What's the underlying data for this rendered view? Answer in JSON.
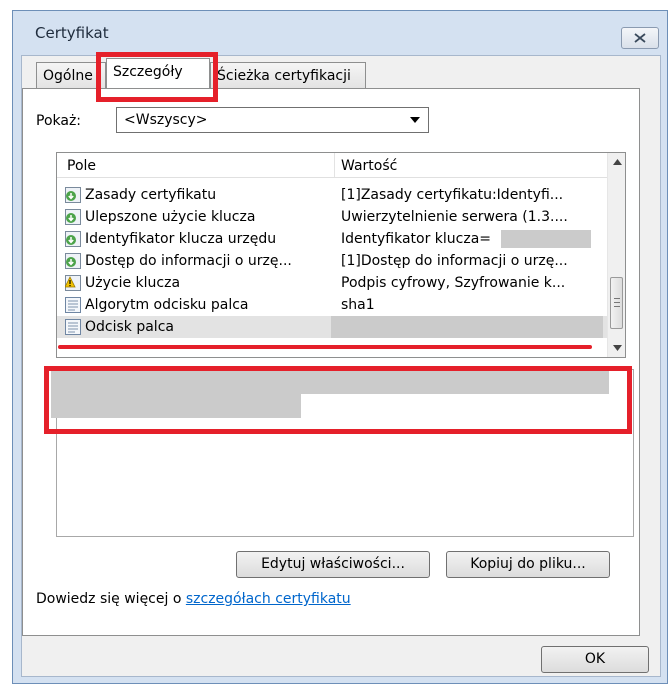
{
  "window": {
    "title": "Certyfikat"
  },
  "tabs": [
    {
      "label": "Ogólne",
      "active": false
    },
    {
      "label": "Szczegóły",
      "active": true
    },
    {
      "label": "Ścieżka certyfikacji",
      "active": false
    }
  ],
  "show_filter": {
    "label": "Pokaż:",
    "selected": "<Wszyscy>"
  },
  "list": {
    "columns": [
      "Pole",
      "Wartość"
    ],
    "rows": [
      {
        "field": "Zasady certyfikatu",
        "value": "[1]Zasady certyfikatu:Identyfi...",
        "icon": "extension-icon"
      },
      {
        "field": "Ulepszone użycie klucza",
        "value": "Uwierzytelnienie serwera (1.3....",
        "icon": "extension-icon"
      },
      {
        "field": "Identyfikator klucza urzędu",
        "value": "Identyfikator klucza=",
        "icon": "extension-icon",
        "redacted": true
      },
      {
        "field": "Dostęp do informacji o urzę...",
        "value": "[1]Dostęp do informacji o urzę...",
        "icon": "extension-icon"
      },
      {
        "field": "Użycie klucza",
        "value": "Podpis cyfrowy, Szyfrowanie k...",
        "icon": "critical-extension-icon"
      },
      {
        "field": "Algorytm odcisku palca",
        "value": "sha1",
        "icon": "property-icon"
      },
      {
        "field": "Odcisk palca",
        "value": "",
        "icon": "property-icon",
        "selected": true,
        "redacted": true
      }
    ]
  },
  "buttons": {
    "edit_properties": "Edytuj właściwości...",
    "copy_to_file": "Kopiuj do pliku...",
    "ok": "OK"
  },
  "learn_more": {
    "prefix": "Dowiedz się więcej o ",
    "link": "szczegółach certyfikatu"
  },
  "colors": {
    "highlight_red": "#e5202a",
    "link_blue": "#0066cc",
    "frame_blue": "#d4e1f1"
  }
}
